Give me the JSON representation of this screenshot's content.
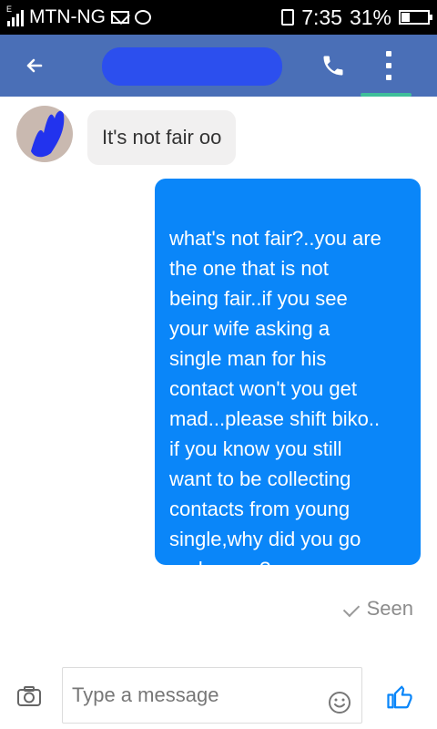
{
  "status_bar": {
    "carrier": "MTN-NG",
    "network_type": "E",
    "time": "7:35",
    "battery": "31%",
    "icons": [
      "signal-icon",
      "mail-icon",
      "chat-notification-icon",
      "vibrate-icon",
      "battery-icon"
    ]
  },
  "app_bar": {
    "back_icon": "arrow-left-icon",
    "call_icon": "phone-call-icon",
    "menu_icon": "more-vertical-icon",
    "accent_color": "#4a6fb7"
  },
  "messages": [
    {
      "direction": "incoming",
      "text": "It's not fair oo"
    },
    {
      "direction": "outgoing",
      "text": "what's not fair?..you are\nthe one that is not\nbeing fair..if you see\nyour wife asking a\nsingle man for his\ncontact won't you get\nmad...please shift biko..\nif you know you still\nwant to be collecting\ncontacts from young\nsingle,why did you go\nand marry?"
    }
  ],
  "seen_label": "Seen",
  "composer": {
    "placeholder": "Type a message",
    "camera_icon": "camera-icon",
    "emoji_icon": "emoji-icon",
    "like_icon": "thumbs-up-icon"
  },
  "colors": {
    "outgoing_bubble": "#0a86f9",
    "incoming_bubble": "#f1f0f0",
    "like_icon": "#0a86f9"
  }
}
